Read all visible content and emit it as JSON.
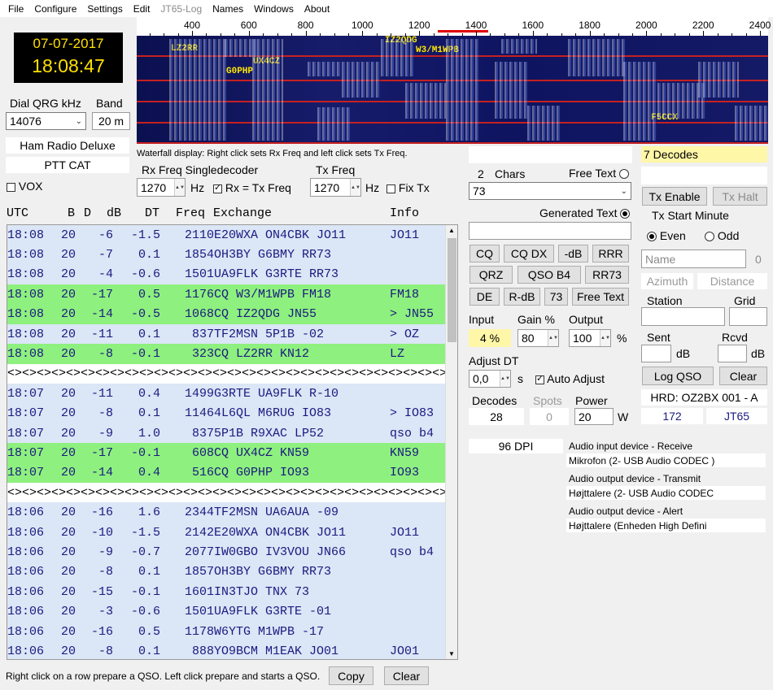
{
  "menu": {
    "items": [
      "File",
      "Configure",
      "Settings",
      "Edit",
      "JT65-Log",
      "Names",
      "Windows",
      "About"
    ],
    "disabled": [
      false,
      false,
      false,
      false,
      true,
      false,
      false,
      false
    ]
  },
  "clock": {
    "date": "07-07-2017",
    "time": "18:08:47"
  },
  "dial": {
    "label": "Dial QRG kHz",
    "value": "14076"
  },
  "band": {
    "label": "Band",
    "value": "20 m"
  },
  "rig": {
    "name": "Ham Radio Deluxe",
    "ptt": "PTT CAT"
  },
  "vox": {
    "label": "VOX",
    "checked": false
  },
  "waterfall": {
    "ticks": [
      "400",
      "600",
      "800",
      "1000",
      "1200",
      "1400",
      "1600",
      "1800",
      "2000",
      "2200",
      "2400"
    ],
    "callsigns": [
      "LZ2RR",
      "UX4CZ",
      "G0PHP",
      "IZ2QDG",
      "W3/M1WPB",
      "F5CCX"
    ],
    "hint": "Waterfall display: Right click sets Rx Freq and left click sets Tx Freq."
  },
  "rxfreq": {
    "label": "Rx Freq Singledecoder",
    "value": "1270",
    "unit": "Hz",
    "rx_eq_tx": "Rx = Tx Freq",
    "rx_eq_tx_checked": true
  },
  "txfreq": {
    "label": "Tx Freq",
    "value": "1270",
    "unit": "Hz",
    "fix_tx": "Fix Tx",
    "fix_tx_checked": false
  },
  "table": {
    "headers": {
      "utc": "UTC",
      "b": "B",
      "d": "D",
      "db": "dB",
      "dt": "DT",
      "freq": "Freq",
      "exchange": "Exchange",
      "info": "Info"
    },
    "rows": [
      {
        "t": "blue",
        "utc": "18:08",
        "b": "20",
        "db": "-6",
        "dt": "-1.5",
        "freq": "2110",
        "ex": "E20WXA ON4CBK JO11",
        "info": "JO11"
      },
      {
        "t": "blue",
        "utc": "18:08",
        "b": "20",
        "db": "-7",
        "dt": "0.1",
        "freq": "1854",
        "ex": "OH3BY G6BMY RR73",
        "info": ""
      },
      {
        "t": "blue",
        "utc": "18:08",
        "b": "20",
        "db": "-4",
        "dt": "-0.6",
        "freq": "1501",
        "ex": "UA9FLK G3RTE RR73",
        "info": ""
      },
      {
        "t": "green",
        "utc": "18:08",
        "b": "20",
        "db": "-17",
        "dt": "0.5",
        "freq": "1176",
        "ex": "CQ W3/M1WPB FM18",
        "info": "FM18"
      },
      {
        "t": "green",
        "utc": "18:08",
        "b": "20",
        "db": "-14",
        "dt": "-0.5",
        "freq": "1068",
        "ex": "CQ IZ2QDG JN55",
        "info": "> JN55"
      },
      {
        "t": "blue",
        "utc": "18:08",
        "b": "20",
        "db": "-11",
        "dt": "0.1",
        "freq": "837",
        "ex": "TF2MSN 5P1B -02",
        "info": "> OZ"
      },
      {
        "t": "green",
        "utc": "18:08",
        "b": "20",
        "db": "-8",
        "dt": "-0.1",
        "freq": "323",
        "ex": "CQ LZ2RR KN12",
        "info": "LZ"
      },
      {
        "t": "sep",
        "text": "<><><><><><><><><><><><><><><><><><><><><><><><><><><><><><><><><><><><>"
      },
      {
        "t": "blue",
        "utc": "18:07",
        "b": "20",
        "db": "-11",
        "dt": "0.4",
        "freq": "1499",
        "ex": "G3RTE UA9FLK R-10",
        "info": ""
      },
      {
        "t": "blue",
        "utc": "18:07",
        "b": "20",
        "db": "-8",
        "dt": "0.1",
        "freq": "1146",
        "ex": "4L6QL M6RUG IO83",
        "info": "> IO83"
      },
      {
        "t": "blue",
        "utc": "18:07",
        "b": "20",
        "db": "-9",
        "dt": "1.0",
        "freq": "837",
        "ex": "5P1B R9XAC LP52",
        "info": "qso b4"
      },
      {
        "t": "green",
        "utc": "18:07",
        "b": "20",
        "db": "-17",
        "dt": "-0.1",
        "freq": "608",
        "ex": "CQ UX4CZ KN59",
        "info": "KN59"
      },
      {
        "t": "green",
        "utc": "18:07",
        "b": "20",
        "db": "-14",
        "dt": "0.4",
        "freq": "516",
        "ex": "CQ G0PHP IO93",
        "info": "IO93"
      },
      {
        "t": "sep",
        "text": "<><><><><><><><><><><><><><><><><><><><><><><><><><><><><><><><><><><><>"
      },
      {
        "t": "blue",
        "utc": "18:06",
        "b": "20",
        "db": "-16",
        "dt": "1.6",
        "freq": "2344",
        "ex": "TF2MSN UA6AUA -09",
        "info": ""
      },
      {
        "t": "blue",
        "utc": "18:06",
        "b": "20",
        "db": "-10",
        "dt": "-1.5",
        "freq": "2142",
        "ex": "E20WXA ON4CBK JO11",
        "info": "JO11"
      },
      {
        "t": "blue",
        "utc": "18:06",
        "b": "20",
        "db": "-9",
        "dt": "-0.7",
        "freq": "2077",
        "ex": "IW0GBO IV3VOU JN66",
        "info": "qso b4"
      },
      {
        "t": "blue",
        "utc": "18:06",
        "b": "20",
        "db": "-8",
        "dt": "0.1",
        "freq": "1857",
        "ex": "OH3BY G6BMY RR73",
        "info": ""
      },
      {
        "t": "blue",
        "utc": "18:06",
        "b": "20",
        "db": "-15",
        "dt": "-0.1",
        "freq": "1601",
        "ex": "IN3TJO TNX 73",
        "info": ""
      },
      {
        "t": "blue",
        "utc": "18:06",
        "b": "20",
        "db": "-3",
        "dt": "-0.6",
        "freq": "1501",
        "ex": "UA9FLK G3RTE -01",
        "info": ""
      },
      {
        "t": "blue",
        "utc": "18:06",
        "b": "20",
        "db": "-16",
        "dt": "0.5",
        "freq": "1178",
        "ex": "W6YTG M1WPB -17",
        "info": ""
      },
      {
        "t": "blue",
        "utc": "18:06",
        "b": "20",
        "db": "-8",
        "dt": "0.1",
        "freq": "888",
        "ex": "YO9BCM M1EAK JO01",
        "info": "JO01"
      }
    ]
  },
  "footer": {
    "hint": "Right click on a row prepare a QSO. Left click prepare and starts a QSO.",
    "copy": "Copy",
    "clear": "Clear"
  },
  "msg": {
    "chars_count": "2",
    "chars_label": "Chars",
    "free_text_label": "Free Text",
    "selected": "73",
    "generated_label": "Generated Text"
  },
  "macros": {
    "cq": "CQ",
    "cqdx": "CQ DX",
    "db": "-dB",
    "rrr": "RRR",
    "qrz": "QRZ",
    "qsob4": "QSO B4",
    "rr73": "RR73",
    "de": "DE",
    "rdb": "R-dB",
    "n73": "73",
    "freetext": "Free Text"
  },
  "levels": {
    "input_label": "Input",
    "input": "4 %",
    "gain_label": "Gain %",
    "gain": "80",
    "output_label": "Output",
    "output": "100",
    "pct": "%"
  },
  "adjust": {
    "label": "Adjust DT",
    "value": "0,0",
    "unit": "s",
    "auto": "Auto Adjust",
    "auto_checked": true
  },
  "stats": {
    "decodes_label": "Decodes",
    "decodes": "28",
    "spots_label": "Spots",
    "spots": "0",
    "power_label": "Power",
    "power": "20",
    "power_unit": "W"
  },
  "dpi": "96 DPI",
  "audio": {
    "in_label": "Audio input device - Receive",
    "in": "Mikrofon (2- USB Audio CODEC )",
    "out_label": "Audio output device - Transmit",
    "out": "Højttalere (2- USB Audio CODEC",
    "alert_label": "Audio output device - Alert",
    "alert": "Højttalere (Enheden High Defini"
  },
  "right": {
    "decodes": "7 Decodes",
    "tx_enable": "Tx Enable",
    "tx_halt": "Tx Halt",
    "tx_start_label": "Tx Start Minute",
    "even": "Even",
    "odd": "Odd",
    "name_placeholder": "Name",
    "name_count": "0",
    "azimuth": "Azimuth",
    "distance": "Distance",
    "station_label": "Station",
    "grid_label": "Grid",
    "sent_label": "Sent",
    "rcvd_label": "Rcvd",
    "db": "dB",
    "log": "Log QSO",
    "clear": "Clear",
    "hrd": "HRD: OZ2BX 001 - A",
    "count": "172",
    "mode": "JT65"
  }
}
